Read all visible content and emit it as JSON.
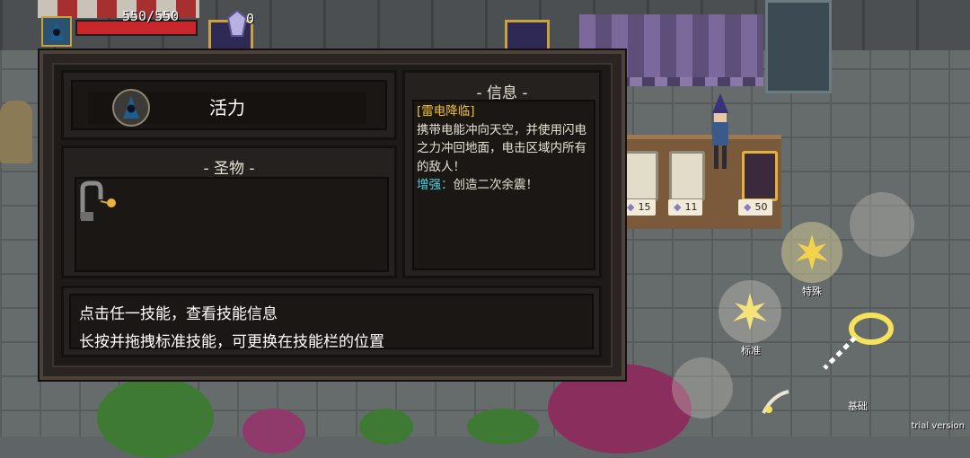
{
  "hud": {
    "hp_text": "550/550",
    "hp_fraction": 1.0,
    "gem_count": "0",
    "portrait_icon": "hooded-wizard-icon",
    "gem_icon": "crystal-gem-icon"
  },
  "panel": {
    "character_name": "活力",
    "character_icon": "hooded-wizard-icon",
    "relic_title": "- 圣物 -",
    "relic_icon": "hook-staff-relic-icon",
    "info_title": "- 信息 -",
    "skill_name": "[雷电降临]",
    "skill_description": "携带电能冲向天空，并使用闪电之力冲回地面，电击区域内所有的敌人！",
    "bonus_label": "增强：",
    "bonus_text": "创造二次余震！",
    "hint_line1": "点击任一技能，查看技能信息",
    "hint_line2": "长按并拖拽标准技能，可更换在技能栏的位置"
  },
  "shop": {
    "prices": [
      "15",
      "11",
      "50"
    ],
    "price_icon": "gem-icon"
  },
  "controls": {
    "special_label": "特殊",
    "standard_label": "标准",
    "basic_label": "基础",
    "special_icon": "lightning-burst-icon",
    "standard_icon": "lightning-burst-icon",
    "dash_icon": "lightning-dash-icon",
    "basic_icon": "arcana-slash-icon"
  },
  "footer": {
    "trial": "trial version"
  },
  "colors": {
    "hp": "#c9262c",
    "skill_name": "#f2c230",
    "bonus": "#4fd3e3",
    "panel_bg": "#2a2522"
  }
}
